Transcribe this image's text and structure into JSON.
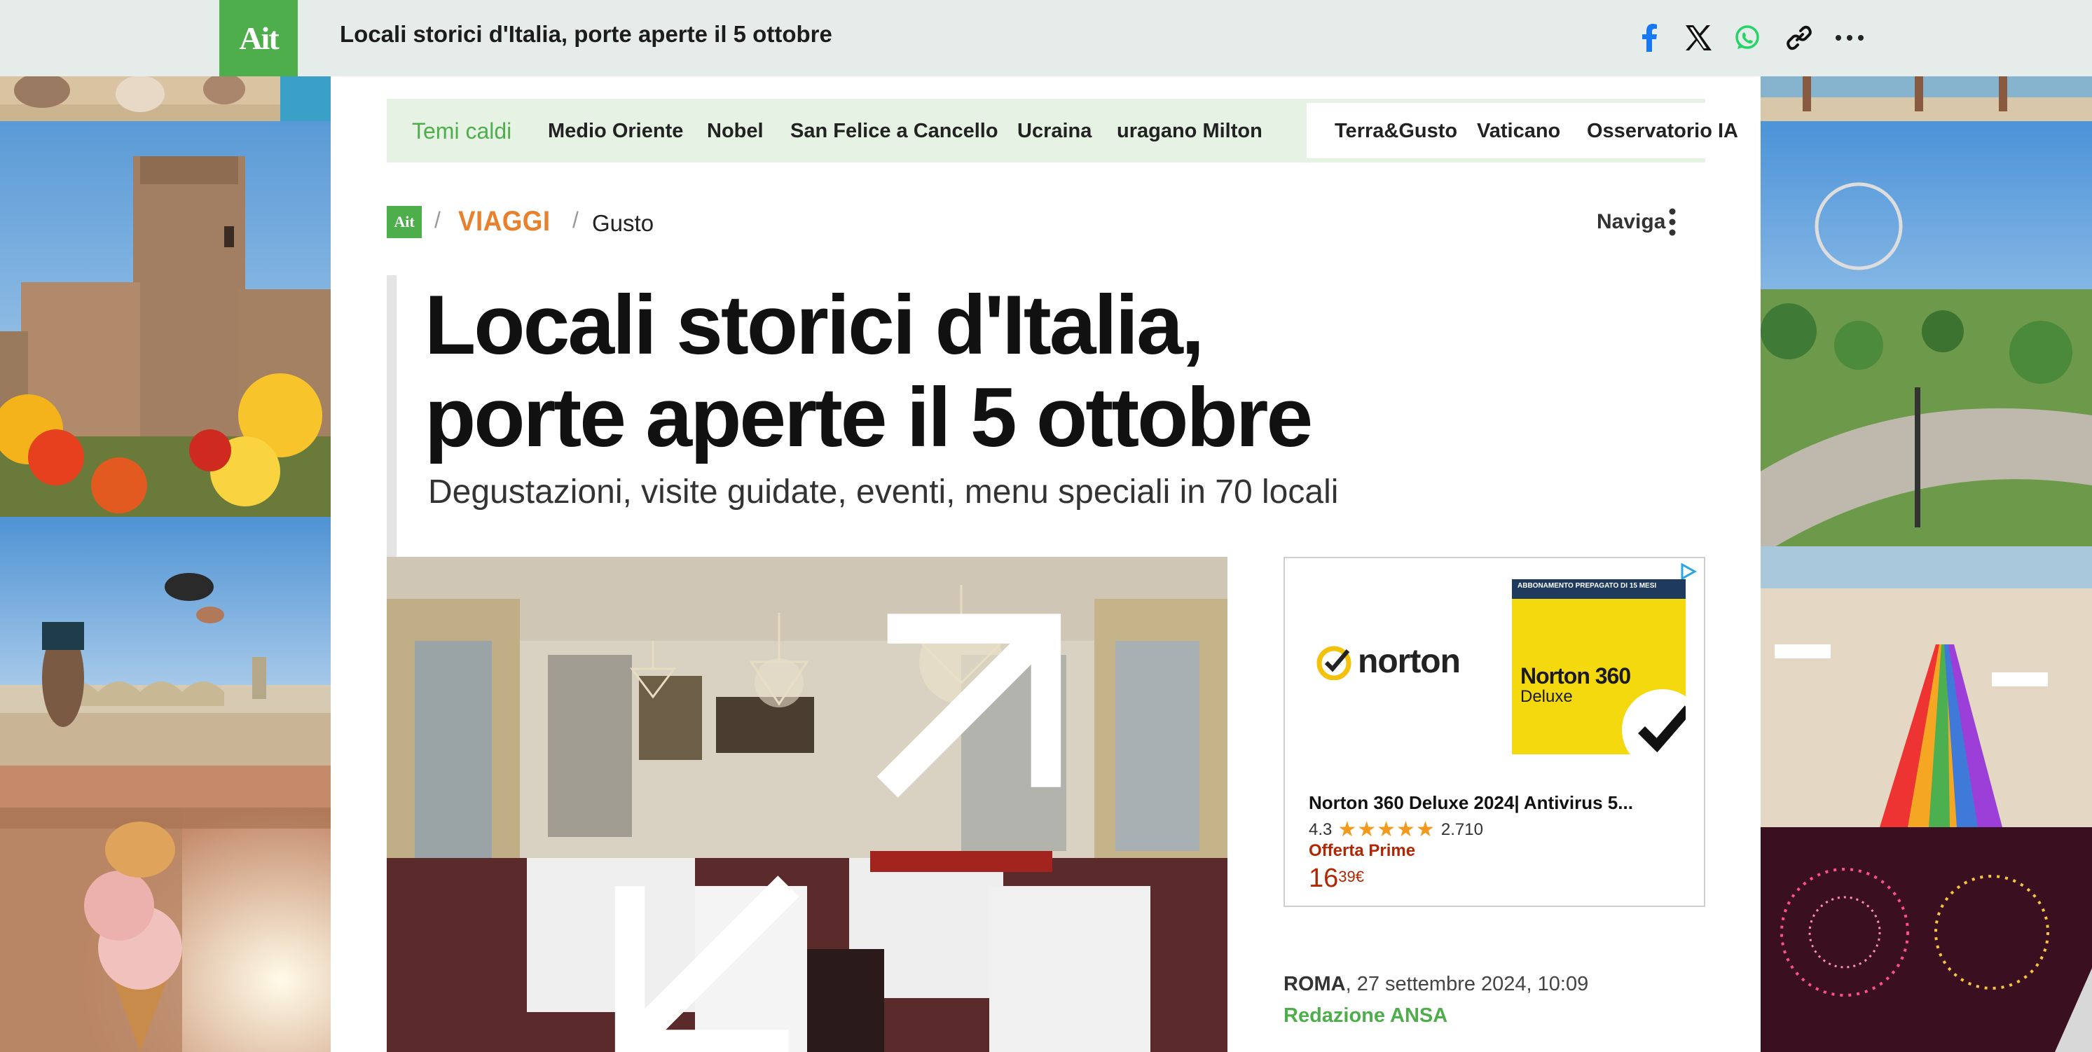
{
  "topbar": {
    "logo": "Ait",
    "title": "Locali storici d'Italia, porte aperte il 5 ottobre",
    "share_icons": [
      "facebook-icon",
      "x-icon",
      "whatsapp-icon",
      "link-icon",
      "more-icon"
    ]
  },
  "hot_topics": {
    "label": "Temi caldi",
    "items": [
      "Medio Oriente",
      "Nobel",
      "San Felice a Cancello",
      "Ucraina",
      "uragano Milton"
    ],
    "right_items": [
      "Terra&Gusto",
      "Vaticano",
      "Osservatorio IA"
    ]
  },
  "breadcrumb": {
    "logo": "Ait",
    "section": "VIAGGI",
    "subsection": "Gusto",
    "naviga": "Naviga"
  },
  "article": {
    "title_line1": "Locali storici d'Italia,",
    "title_line2": "porte aperte il 5 ottobre",
    "subtitle": "Degustazioni, visite guidate, eventi, menu speciali in 70 locali",
    "city": "ROMA",
    "date": ", 27 settembre 2024, 10:09",
    "author": "Redazione ANSA"
  },
  "ad": {
    "brand": "norton",
    "box_top": "ABBONAMENTO PREPAGATO DI 15 MESI",
    "box_n360": "Norton 360",
    "box_deluxe": "Deluxe",
    "product": "Norton 360 Deluxe 2024| Antivirus 5...",
    "rating": "4.3",
    "stars": "★★★★★",
    "reviews": "2.710",
    "offer": "Offerta Prime",
    "price_int": "16",
    "price_dec": "39",
    "currency": "€"
  },
  "colors": {
    "brand_green": "#4fae4c",
    "viaggi_orange": "#e8812d",
    "price_red": "#b12704"
  }
}
